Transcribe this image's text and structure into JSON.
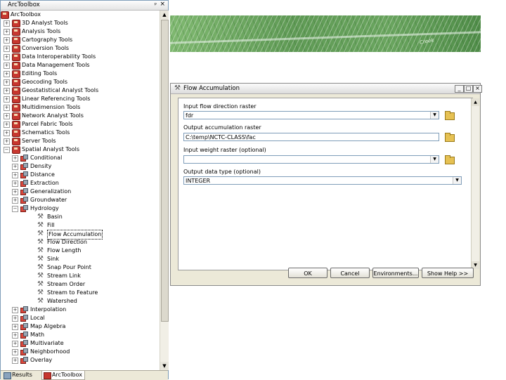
{
  "toolbox": {
    "title": "ArcToolbox",
    "pin_glyph": "ᵖ",
    "close_glyph": "×",
    "root_label": "ArcToolbox",
    "toolboxes": [
      "3D Analyst Tools",
      "Analysis Tools",
      "Cartography Tools",
      "Conversion Tools",
      "Data Interoperability Tools",
      "Data Management Tools",
      "Editing Tools",
      "Geocoding Tools",
      "Geostatistical Analyst Tools",
      "Linear Referencing Tools",
      "Multidimension Tools",
      "Network Analyst Tools",
      "Parcel Fabric Tools",
      "Schematics Tools",
      "Server Tools",
      "Spatial Analyst Tools"
    ],
    "spatial_toolsets_before": [
      "Conditional",
      "Density",
      "Distance",
      "Extraction",
      "Generalization",
      "Groundwater",
      "Hydrology"
    ],
    "hydrology_tools": [
      "Basin",
      "Fill",
      "Flow Accumulation",
      "Flow Direction",
      "Flow Length",
      "Sink",
      "Snap Pour Point",
      "Stream Link",
      "Stream Order",
      "Stream to Feature",
      "Watershed"
    ],
    "selected_tool": "Flow Accumulation",
    "spatial_toolsets_after": [
      "Interpolation",
      "Local",
      "Map Algebra",
      "Math",
      "Multivariate",
      "Neighborhood",
      "Overlay"
    ],
    "tabs": {
      "results": "Results",
      "arctoolbox": "ArcToolbox"
    }
  },
  "map": {
    "label": "Creek"
  },
  "dialog": {
    "title": "Flow Accumulation",
    "window_buttons": {
      "minimize": "_",
      "maximize": "□",
      "close": "×"
    },
    "fields": {
      "input_flow_label": "Input flow direction raster",
      "input_flow_value": "fdr",
      "output_label": "Output accumulation raster",
      "output_value": "C:\\temp\\NCTC-CLASS\\fac",
      "weight_label": "Input weight raster (optional)",
      "weight_value": "",
      "dtype_label": "Output data type (optional)",
      "dtype_value": "INTEGER"
    },
    "buttons": {
      "ok": "OK",
      "cancel": "Cancel",
      "environments": "Environments...",
      "show_help": "Show Help >>"
    }
  }
}
